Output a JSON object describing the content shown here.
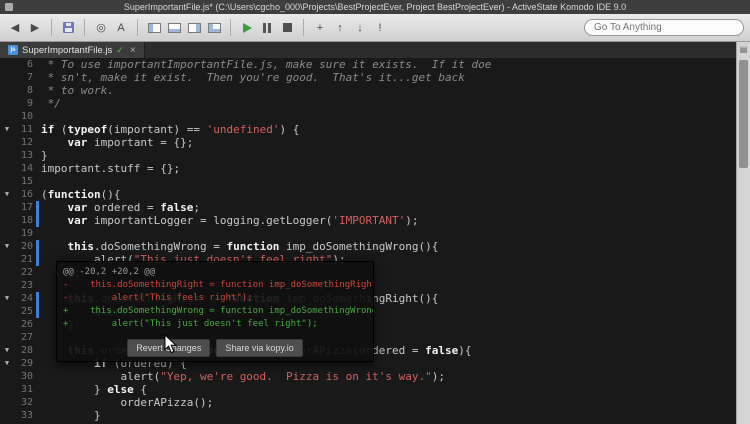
{
  "window": {
    "title": "SuperImportantFile.js* (C:\\Users\\cgcho_000\\Projects\\BestProjectEver, Project BestProjectEver) - ActiveState Komodo IDE 9.0"
  },
  "toolbar": {
    "items": [
      {
        "name": "back-button",
        "kind": "glyph",
        "glyph": "◀"
      },
      {
        "name": "forward-button",
        "kind": "glyph",
        "glyph": "▶"
      },
      {
        "name": "sep1",
        "kind": "sep"
      },
      {
        "name": "save-button",
        "kind": "floppy"
      },
      {
        "name": "sep2",
        "kind": "sep"
      },
      {
        "name": "preview-button",
        "kind": "glyph",
        "glyph": "◎"
      },
      {
        "name": "color-scheme-button",
        "kind": "glyph",
        "glyph": "A"
      },
      {
        "name": "sep3",
        "kind": "sep"
      },
      {
        "name": "toggle-left-pane-button",
        "kind": "layout",
        "variant": "left"
      },
      {
        "name": "toggle-bottom-pane-button",
        "kind": "layout",
        "variant": "bottom"
      },
      {
        "name": "toggle-right-pane-button",
        "kind": "layout",
        "variant": "right"
      },
      {
        "name": "toggle-all-panes-button",
        "kind": "layout",
        "variant": "all"
      },
      {
        "name": "sep4",
        "kind": "sep"
      },
      {
        "name": "run-button",
        "kind": "play"
      },
      {
        "name": "pause-button",
        "kind": "pause"
      },
      {
        "name": "stop-button",
        "kind": "stop"
      },
      {
        "name": "sep5",
        "kind": "sep"
      },
      {
        "name": "add-button",
        "kind": "glyph",
        "glyph": "+"
      },
      {
        "name": "jump-prev-button",
        "kind": "glyph",
        "glyph": "↑"
      },
      {
        "name": "jump-next-button",
        "kind": "glyph",
        "glyph": "↓"
      },
      {
        "name": "breakpoint-button",
        "kind": "glyph",
        "glyph": "!"
      }
    ],
    "search": {
      "placeholder": "Go To Anything"
    }
  },
  "tabbar": {
    "tab": {
      "label": "SuperImportantFile.js",
      "badge": "js",
      "check_icon": "✓",
      "close_icon": "×"
    }
  },
  "rail": {
    "icon": "▤"
  },
  "editor": {
    "fold_icon": "▼",
    "lines": [
      {
        "n": 6,
        "s": [
          [
            "c",
            " * To use importantImportantFile.js, make sure it exists.  If it doe"
          ]
        ]
      },
      {
        "n": 7,
        "s": [
          [
            "c",
            " * sn't, make it exist.  Then you're good.  That's it...get back"
          ]
        ]
      },
      {
        "n": 8,
        "s": [
          [
            "c",
            " * to work."
          ]
        ]
      },
      {
        "n": 9,
        "s": [
          [
            "c",
            " */"
          ]
        ]
      },
      {
        "n": 10,
        "s": []
      },
      {
        "n": 11,
        "f": true,
        "s": [
          [
            "k",
            "if"
          ],
          [
            "p",
            " ("
          ],
          [
            "k",
            "typeof"
          ],
          [
            "p",
            "(important) == "
          ],
          [
            "str",
            "'undefined'"
          ],
          [
            "p",
            ") {"
          ]
        ]
      },
      {
        "n": 12,
        "s": [
          [
            "p",
            "    "
          ],
          [
            "k",
            "var"
          ],
          [
            "p",
            " important = {};"
          ]
        ]
      },
      {
        "n": 13,
        "s": [
          [
            "p",
            "}"
          ]
        ]
      },
      {
        "n": 14,
        "s": [
          [
            "p",
            "important.stuff = {};"
          ]
        ]
      },
      {
        "n": 15,
        "s": []
      },
      {
        "n": 16,
        "f": true,
        "s": [
          [
            "p",
            "("
          ],
          [
            "k",
            "function"
          ],
          [
            "p",
            "(){"
          ]
        ]
      },
      {
        "n": 17,
        "m": true,
        "s": [
          [
            "p",
            "    "
          ],
          [
            "k",
            "var"
          ],
          [
            "p",
            " ordered = "
          ],
          [
            "k",
            "false"
          ],
          [
            "p",
            ";"
          ]
        ]
      },
      {
        "n": 18,
        "m": true,
        "s": [
          [
            "p",
            "    "
          ],
          [
            "k",
            "var"
          ],
          [
            "p",
            " importantLogger = logging.getLogger("
          ],
          [
            "str",
            "'IMPORTANT'"
          ],
          [
            "p",
            ");"
          ]
        ]
      },
      {
        "n": 19,
        "s": []
      },
      {
        "n": 20,
        "f": true,
        "m": true,
        "s": [
          [
            "p",
            "    "
          ],
          [
            "k",
            "this"
          ],
          [
            "p",
            ".doSomethingWrong = "
          ],
          [
            "k",
            "function"
          ],
          [
            "p",
            " imp_doSomethingWrong(){"
          ]
        ]
      },
      {
        "n": 21,
        "m": true,
        "s": [
          [
            "p",
            "        alert("
          ],
          [
            "str",
            "\"This just doesn't feel right\""
          ],
          [
            "p",
            ");"
          ]
        ]
      },
      {
        "n": 22,
        "s": [
          [
            "p",
            "    };"
          ]
        ]
      },
      {
        "n": 23,
        "s": []
      },
      {
        "n": 24,
        "f": true,
        "m": true,
        "s": [
          [
            "p",
            "    "
          ],
          [
            "k",
            "this"
          ],
          [
            "p",
            ".doSomethingRight = "
          ],
          [
            "k",
            "function"
          ],
          [
            "p",
            " imp_doSomethingRight(){"
          ]
        ]
      },
      {
        "n": 25,
        "m": true,
        "s": [
          [
            "p",
            "        alert("
          ],
          [
            "str",
            "\"This feels right\""
          ],
          [
            "p",
            ");"
          ]
        ]
      },
      {
        "n": 26,
        "s": [
          [
            "p",
            "    };"
          ]
        ]
      },
      {
        "n": 27,
        "s": []
      },
      {
        "n": 28,
        "f": true,
        "s": [
          [
            "p",
            "    "
          ],
          [
            "k",
            "this"
          ],
          [
            "p",
            ".orderAPizza = "
          ],
          [
            "k",
            "function"
          ],
          [
            "p",
            " imp_orderAPizza(ordered = "
          ],
          [
            "k",
            "false"
          ],
          [
            "p",
            "){"
          ]
        ]
      },
      {
        "n": 29,
        "f": true,
        "s": [
          [
            "p",
            "        "
          ],
          [
            "k",
            "if"
          ],
          [
            "p",
            " (ordered) {"
          ]
        ]
      },
      {
        "n": 30,
        "s": [
          [
            "p",
            "            alert("
          ],
          [
            "str",
            "\"Yep, we're good.  Pizza is on it's way.\""
          ],
          [
            "p",
            ");"
          ]
        ]
      },
      {
        "n": 31,
        "s": [
          [
            "p",
            "        } "
          ],
          [
            "k",
            "else"
          ],
          [
            "p",
            " {"
          ]
        ]
      },
      {
        "n": 32,
        "s": [
          [
            "p",
            "            orderAPizza();"
          ]
        ]
      },
      {
        "n": 33,
        "s": [
          [
            "p",
            "        }"
          ]
        ]
      }
    ]
  },
  "diff_popup": {
    "header": "@@ -20,2 +20,2 @@",
    "lines": [
      {
        "kind": "del",
        "text": "-    this.doSomethingRight = function imp_doSomethingRight(){"
      },
      {
        "kind": "del",
        "text": "-        alert(\"This feels right\");"
      },
      {
        "kind": "add",
        "text": "+    this.doSomethingWrong = function imp_doSomethingWrong(){"
      },
      {
        "kind": "add",
        "text": "+        alert(\"This just doesn't feel right\");"
      }
    ],
    "buttons": [
      {
        "name": "revert-changes-button",
        "label": "Revert Changes"
      },
      {
        "name": "share-kopy-button",
        "label": "Share via kopy.io"
      }
    ]
  },
  "colors": {
    "change_marker": "#3f7fd6",
    "deletion": "#c8453a",
    "addition": "#47a83f",
    "string": "#d2615e",
    "editor_bg": "#191919"
  }
}
